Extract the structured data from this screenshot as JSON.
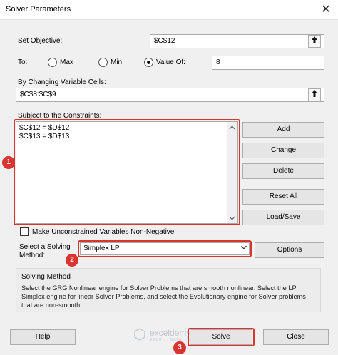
{
  "window": {
    "title": "Solver Parameters",
    "close_glyph": "✕"
  },
  "objective": {
    "label": "Set Objective:",
    "value": "$C$12"
  },
  "to": {
    "label": "To:",
    "options": [
      {
        "label": "Max",
        "selected": false
      },
      {
        "label": "Min",
        "selected": false
      },
      {
        "label": "Value Of:",
        "selected": true
      }
    ],
    "value_of": "8"
  },
  "changing": {
    "label": "By Changing Variable Cells:",
    "value": "$C$8:$C$9"
  },
  "constraints": {
    "label": "Subject to the Constraints:",
    "items": [
      "$C$12 = $D$12",
      "$C$13 = $D$13"
    ]
  },
  "constraint_buttons": {
    "add": "Add",
    "change": "Change",
    "delete": "Delete",
    "reset_all": "Reset All",
    "load_save": "Load/Save"
  },
  "non_negative": {
    "label": "Make Unconstrained Variables Non-Negative",
    "checked": false
  },
  "solving_method": {
    "label_line1": "Select a Solving",
    "label_line2": "Method:",
    "selected": "Simplex LP",
    "options_button": "Options"
  },
  "method_info": {
    "heading": "Solving Method",
    "description": "Select the GRG Nonlinear engine for Solver Problems that are smooth nonlinear. Select the LP Simplex engine for linear Solver Problems, and select the Evolutionary engine for Solver problems that are non-smooth."
  },
  "footer": {
    "help": "Help",
    "solve": "Solve",
    "close": "Close"
  },
  "badges": [
    "1",
    "2",
    "3"
  ],
  "watermark": {
    "text": "exceldemy",
    "sub": "EXCEL · DATA · BI"
  },
  "colors": {
    "highlight": "#d9352e",
    "window_bg": "#f0f0f0"
  },
  "icons": {
    "cell_picker": "collapse-dialog-icon",
    "scroll_up": "scroll-up-icon",
    "scroll_down": "scroll-down-icon",
    "dropdown": "dropdown-arrow-icon"
  }
}
